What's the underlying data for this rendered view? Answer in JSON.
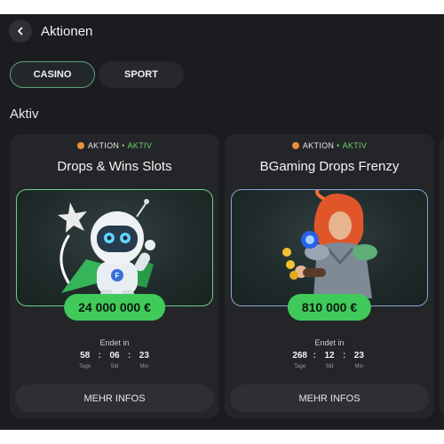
{
  "header": {
    "title": "Aktionen",
    "back_icon": "chevron-left-icon"
  },
  "tabs": [
    {
      "label": "CASINO",
      "active": true
    },
    {
      "label": "SPORT",
      "active": false
    }
  ],
  "section_title": "Aktiv",
  "colors": {
    "accent_green": "#3fca5a",
    "status_green": "#6fd06f",
    "background": "#1b1c1f",
    "card": "#242528"
  },
  "cards": [
    {
      "tag": "AKTION",
      "separator": "•",
      "status": "AKTIV",
      "title": "Drops & Wins Slots",
      "image": "astronaut-mascot-illustration",
      "amount": "24 000 000 €",
      "ends_label": "Endet in",
      "timer": [
        {
          "value": "58",
          "unit": "Tage"
        },
        {
          "value": "06",
          "unit": "Std"
        },
        {
          "value": "23",
          "unit": "Min"
        }
      ],
      "timer_separator": ":",
      "button": "MEHR INFOS"
    },
    {
      "tag": "AKTION",
      "separator": "•",
      "status": "AKTIV",
      "title": "BGaming Drops Frenzy",
      "image": "red-haired-wizard-illustration",
      "amount": "810 000 €",
      "ends_label": "Endet in",
      "timer": [
        {
          "value": "268",
          "unit": "Tage"
        },
        {
          "value": "12",
          "unit": "Std"
        },
        {
          "value": "23",
          "unit": "Min"
        }
      ],
      "timer_separator": ":",
      "button": "MEHR INFOS"
    }
  ]
}
